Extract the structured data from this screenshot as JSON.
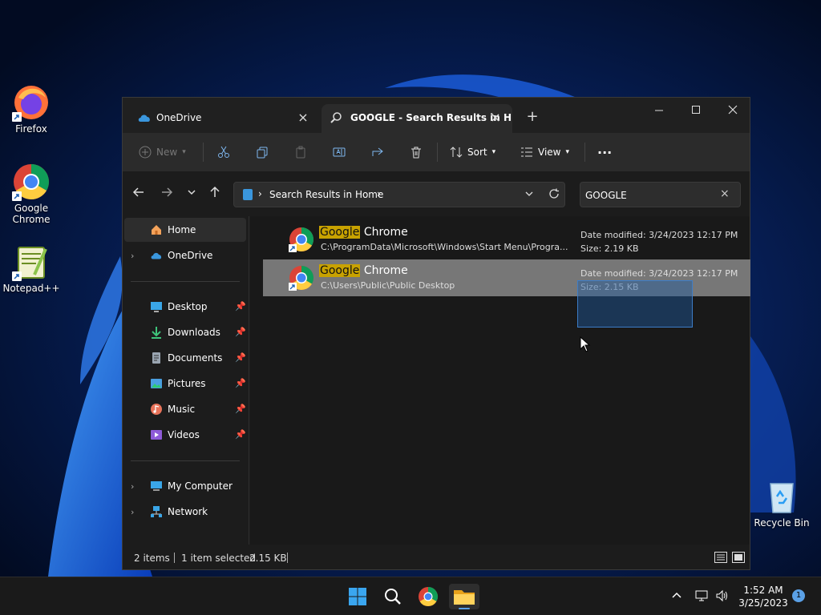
{
  "desktop": {
    "icons": [
      {
        "label": "Firefox"
      },
      {
        "label": "Google\nChrome"
      },
      {
        "label": "Notepad++"
      },
      {
        "label": "Recycle Bin"
      }
    ]
  },
  "window": {
    "tabs": [
      {
        "label": "OneDrive"
      },
      {
        "label": "GOOGLE - Search Results in H"
      }
    ],
    "toolbar": {
      "new_label": "New",
      "sort_label": "Sort",
      "view_label": "View",
      "more_label": "···"
    },
    "address": {
      "breadcrumb": "Search Results in Home"
    },
    "search": {
      "value": "GOOGLE"
    },
    "sidebar": {
      "items": [
        {
          "label": "Home"
        },
        {
          "label": "OneDrive"
        },
        {
          "label": "Desktop"
        },
        {
          "label": "Downloads"
        },
        {
          "label": "Documents"
        },
        {
          "label": "Pictures"
        },
        {
          "label": "Music"
        },
        {
          "label": "Videos"
        },
        {
          "label": "My Computer"
        },
        {
          "label": "Network"
        }
      ]
    },
    "files": [
      {
        "name_highlight": "Google",
        "name_rest": " Chrome",
        "path": "C:\\ProgramData\\Microsoft\\Windows\\Start Menu\\Progra...",
        "modified": "Date modified: 3/24/2023 12:17 PM",
        "size": "Size: 2.19 KB",
        "selected": false
      },
      {
        "name_highlight": "Google",
        "name_rest": " Chrome",
        "path": "C:\\Users\\Public\\Public Desktop",
        "modified": "Date modified: 3/24/2023 12:17 PM",
        "size": "Size: 2.15 KB",
        "selected": true
      }
    ],
    "status": {
      "count": "2 items",
      "selection": "1 item selected",
      "size": "2.15 KB"
    }
  },
  "taskbar": {
    "time": "1:52 AM",
    "date": "3/25/2023",
    "notifications": "1"
  },
  "colors": {
    "accent": "#0078d4",
    "highlight": "#c8a200",
    "selection": "#777777"
  }
}
